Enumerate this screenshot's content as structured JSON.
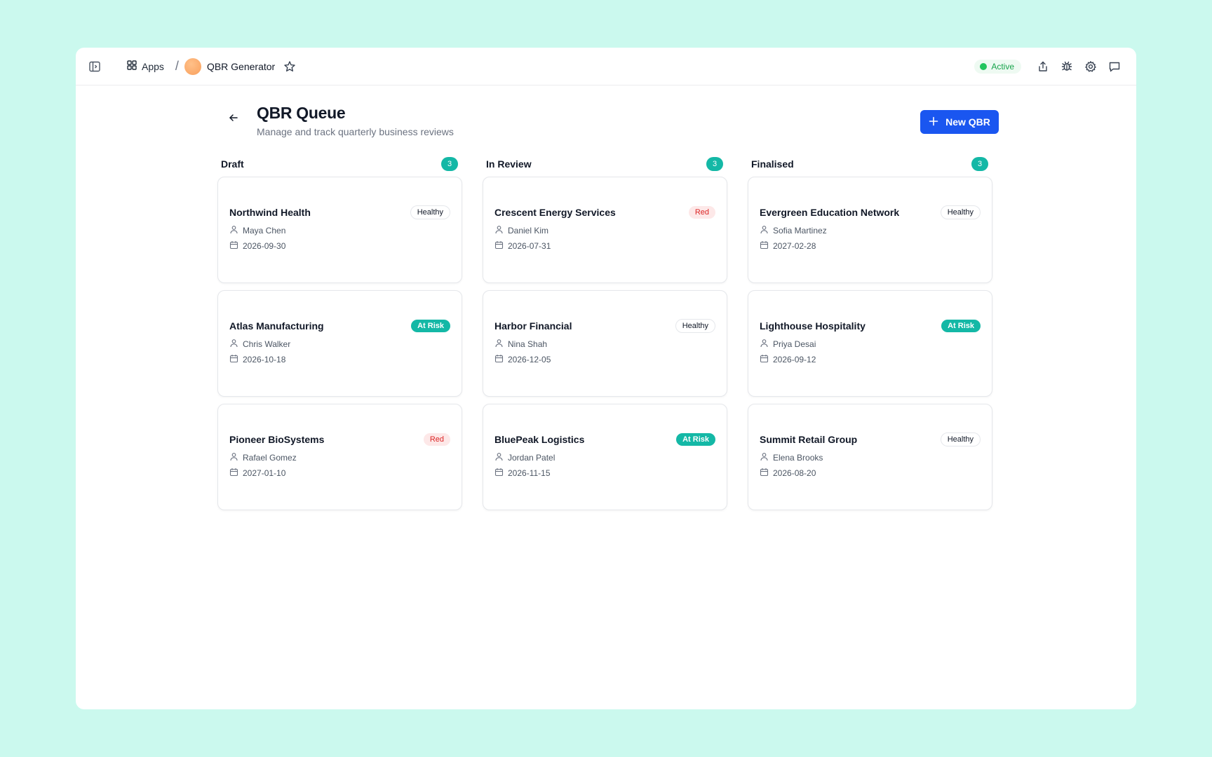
{
  "topbar": {
    "apps_label": "Apps",
    "app_name": "QBR Generator",
    "status_label": "Active"
  },
  "page": {
    "title": "QBR Queue",
    "subtitle": "Manage and track quarterly business reviews",
    "new_button_label": "New QBR"
  },
  "columns": [
    {
      "title": "Draft",
      "count": "3",
      "cards": [
        {
          "name": "Northwind Health",
          "status": "Healthy",
          "owner": "Maya Chen",
          "date": "2026-09-30"
        },
        {
          "name": "Atlas Manufacturing",
          "status": "At Risk",
          "owner": "Chris Walker",
          "date": "2026-10-18"
        },
        {
          "name": "Pioneer BioSystems",
          "status": "Red",
          "owner": "Rafael Gomez",
          "date": "2027-01-10"
        }
      ]
    },
    {
      "title": "In Review",
      "count": "3",
      "cards": [
        {
          "name": "Crescent Energy Services",
          "status": "Red",
          "owner": "Daniel Kim",
          "date": "2026-07-31"
        },
        {
          "name": "Harbor Financial",
          "status": "Healthy",
          "owner": "Nina Shah",
          "date": "2026-12-05"
        },
        {
          "name": "BluePeak Logistics",
          "status": "At Risk",
          "owner": "Jordan Patel",
          "date": "2026-11-15"
        }
      ]
    },
    {
      "title": "Finalised",
      "count": "3",
      "cards": [
        {
          "name": "Evergreen Education Network",
          "status": "Healthy",
          "owner": "Sofia Martinez",
          "date": "2027-02-28"
        },
        {
          "name": "Lighthouse Hospitality",
          "status": "At Risk",
          "owner": "Priya Desai",
          "date": "2026-09-12"
        },
        {
          "name": "Summit Retail Group",
          "status": "Healthy",
          "owner": "Elena Brooks",
          "date": "2026-08-20"
        }
      ]
    }
  ],
  "colors": {
    "page_background": "#cbf9ee",
    "primary": "#1a56f0",
    "teal": "#14b8a6",
    "red_text": "#dc2626",
    "active_green": "#22c55e"
  }
}
